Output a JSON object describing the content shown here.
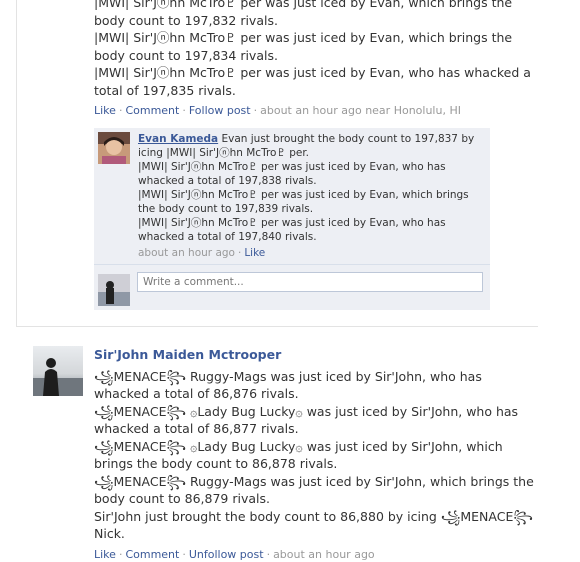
{
  "post1": {
    "lines": [
      "|MWI| Sir'Jⓝhn McTro♇ per was just iced by Evan, which brings the body count to 197,832 rivals.",
      "|MWI| Sir'Jⓝhn McTro♇ per was just iced by Evan, which brings the body count to 197,834 rivals.",
      "|MWI| Sir'Jⓝhn McTro♇ per was just iced by Evan, who has whacked a total of 197,835 rivals."
    ],
    "actions": {
      "like": "Like",
      "comment": "Comment",
      "follow": "Follow post",
      "time": "about an hour ago near Honolulu, HI"
    }
  },
  "comment": {
    "author": "Evan Kameda",
    "text_first": "Evan just brought the body count to 197,837 by icing |MWI| Sir'Jⓝhn McTro♇ per.",
    "lines": [
      "|MWI| Sir'Jⓝhn McTro♇ per was just iced by Evan, who has whacked a total of 197,838 rivals.",
      "|MWI| Sir'Jⓝhn McTro♇ per was just iced by Evan, which brings the body count to 197,839 rivals.",
      "|MWI| Sir'Jⓝhn McTro♇ per was just iced by Evan, who has whacked a total of 197,840 rivals."
    ],
    "time": "about an hour ago",
    "like": "Like"
  },
  "write_comment": {
    "placeholder": "Write a comment..."
  },
  "post2": {
    "author": "Sir'John Maiden Mctrooper",
    "lines": [
      "꧁MENACE꧂ Ruggy-Mags was just iced by Sir'John, who has whacked a total of 86,876 rivals.",
      "꧁MENACE꧂ ۞Lady Bug Lucky۞ was just iced by Sir'John, who has whacked a total of 86,877 rivals.",
      "꧁MENACE꧂ ۞Lady Bug Lucky۞ was just iced by Sir'John, which brings the body count to 86,878 rivals.",
      "꧁MENACE꧂ Ruggy-Mags was just iced by Sir'John, which brings the body count to 86,879 rivals.",
      "Sir'John just brought the body count to 86,880 by icing ꧁MENACE꧂ Nick."
    ],
    "actions": {
      "like": "Like",
      "comment": "Comment",
      "unfollow": "Unfollow post",
      "time": "about an hour ago"
    }
  }
}
